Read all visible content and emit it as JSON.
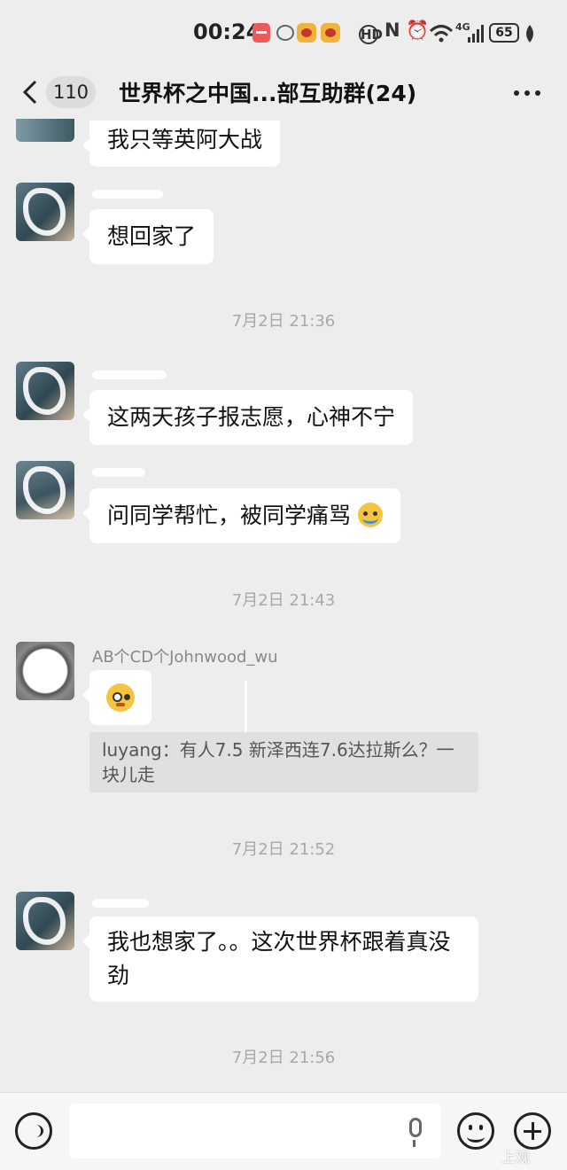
{
  "status_bar": {
    "time": "00:24",
    "icons": [
      "red-notification-icon",
      "message-bubble-icon",
      "weibo-eye-icon",
      "weibo-eye-icon",
      "hd-call-icon",
      "nfc-icon",
      "alarm-icon",
      "wifi-icon",
      "signal-4g-icon",
      "leaf-icon"
    ],
    "glyph_hd": "HD",
    "glyph_nfc": "N",
    "glyph_signal": "4G",
    "battery": "65"
  },
  "header": {
    "back_count": "110",
    "title": "世界杯之中国...部互助群(24)"
  },
  "messages": [
    {
      "text": "我只等英阿大战"
    },
    {
      "text": "想回家了"
    },
    {
      "time": "7月2日 21:36"
    },
    {
      "text": "这两天孩子报志愿，心神不宁"
    },
    {
      "text": "问同学帮忙，被同学痛骂"
    },
    {
      "time": "7月2日 21:43"
    },
    {
      "sender": "AB个CD个Johnwood_wu"
    },
    {
      "quote": "luyang：有人7.5 新泽西连7.6达拉斯么？一块儿走"
    },
    {
      "time": "7月2日 21:52"
    },
    {
      "text": "我也想家了。。这次世界杯跟着真没劲"
    },
    {
      "time": "7月2日 21:56"
    }
  ],
  "input_bar": {
    "placeholder": ""
  },
  "watermark": "上观",
  "colors": {
    "background": "#ededed",
    "bubble": "#ffffff",
    "quote": "#e0e0e0",
    "timestamp": "#a8a8a8"
  }
}
